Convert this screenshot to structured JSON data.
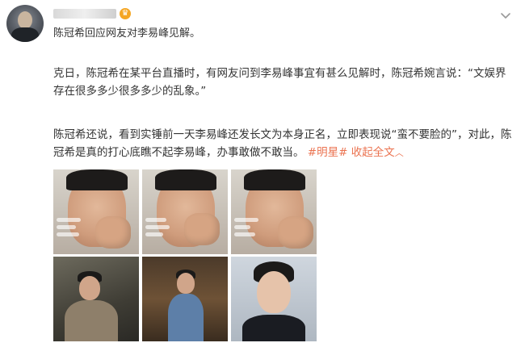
{
  "post": {
    "username": "",
    "summary": "陈冠希回应网友对李易峰见解。",
    "paragraph1": "克日，陈冠希在某平台直播时，有网友问到李易峰事宜有甚么见解时，陈冠希婉言说：“文娱界存在很多多少很多多少的乱象。”",
    "paragraph2": "陈冠希还说，看到实锤前一天李易峰还发长文为本身正名，立即表现说“蛮不要脸的”，对此，陈冠希是真的打心底瞧不起李易峰，办事敢做不敢当。",
    "hashtag": "#明星#",
    "collapse_label": "收起全文",
    "collapse_icon": "chevron-up-icon",
    "vip_badge": "crown-icon",
    "more_icon": "chevron-down-icon"
  },
  "colors": {
    "text": "#333333",
    "accent": "#eb7350",
    "secondary": "#999999"
  }
}
